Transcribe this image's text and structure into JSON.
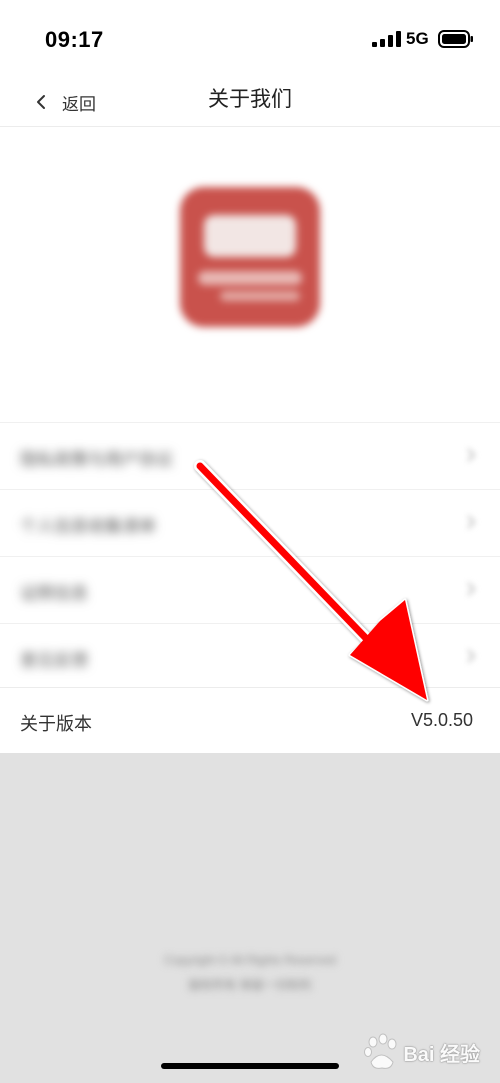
{
  "status_bar": {
    "time": "09:17",
    "network": "5G"
  },
  "nav": {
    "back_label": "返回",
    "title": "关于我们"
  },
  "menu": {
    "items": [
      {
        "label": "隐私政策与用户协议"
      },
      {
        "label": "个人信息收集清单"
      },
      {
        "label": "证照信息"
      },
      {
        "label": "意见反馈"
      }
    ]
  },
  "version": {
    "label": "关于版本",
    "value": "V5.0.50"
  },
  "footer": {
    "line1": "Copyright © All Rights Reserved",
    "line2": "版权所有 保留一切权利"
  },
  "watermark": {
    "text": "Bai 经验"
  },
  "colors": {
    "annotation_arrow": "#ff0000",
    "logo": "#c9524c",
    "background": "#e1e1e1"
  }
}
